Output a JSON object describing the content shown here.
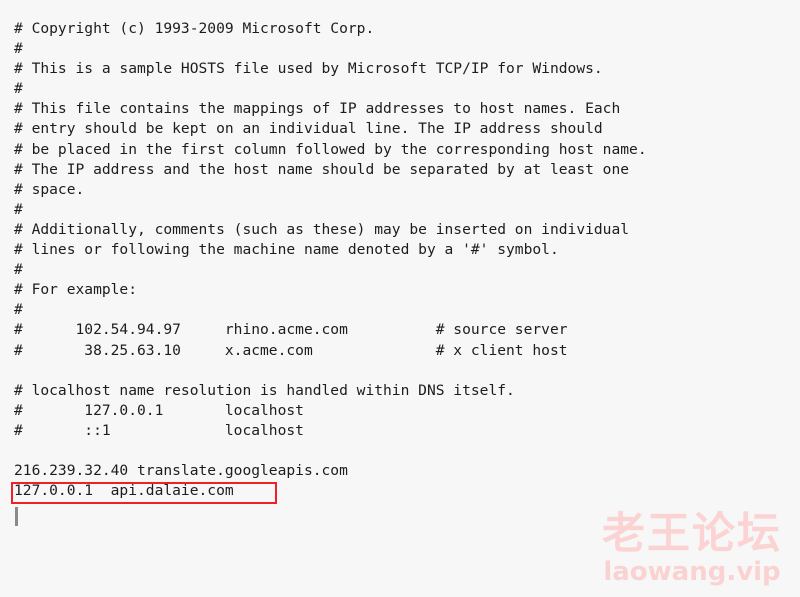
{
  "document": {
    "kind": "windows-hosts-file",
    "background_color": "#f7f7f7",
    "text_color": "#1d1d1d",
    "lines": [
      "# Copyright (c) 1993-2009 Microsoft Corp.",
      "#",
      "# This is a sample HOSTS file used by Microsoft TCP/IP for Windows.",
      "#",
      "# This file contains the mappings of IP addresses to host names. Each",
      "# entry should be kept on an individual line. The IP address should",
      "# be placed in the first column followed by the corresponding host name.",
      "# The IP address and the host name should be separated by at least one",
      "# space.",
      "#",
      "# Additionally, comments (such as these) may be inserted on individual",
      "# lines or following the machine name denoted by a '#' symbol.",
      "#",
      "# For example:",
      "#",
      "#      102.54.94.97     rhino.acme.com          # source server",
      "#       38.25.63.10     x.acme.com              # x client host",
      "",
      "# localhost name resolution is handled within DNS itself.",
      "#       127.0.0.1       localhost",
      "#       ::1             localhost",
      "",
      "216.239.32.40 translate.googleapis.com",
      "127.0.0.1  api.dalaie.com"
    ]
  },
  "annotation": {
    "highlight": {
      "target_line": "127.0.0.1  api.dalaie.com",
      "color": "#ef2027",
      "shape": "rectangle"
    },
    "caret": {
      "color": "#8a8a8a"
    }
  },
  "watermark": {
    "title": "老王论坛",
    "url": "laowang.vip",
    "color": "#fbd3d3"
  }
}
